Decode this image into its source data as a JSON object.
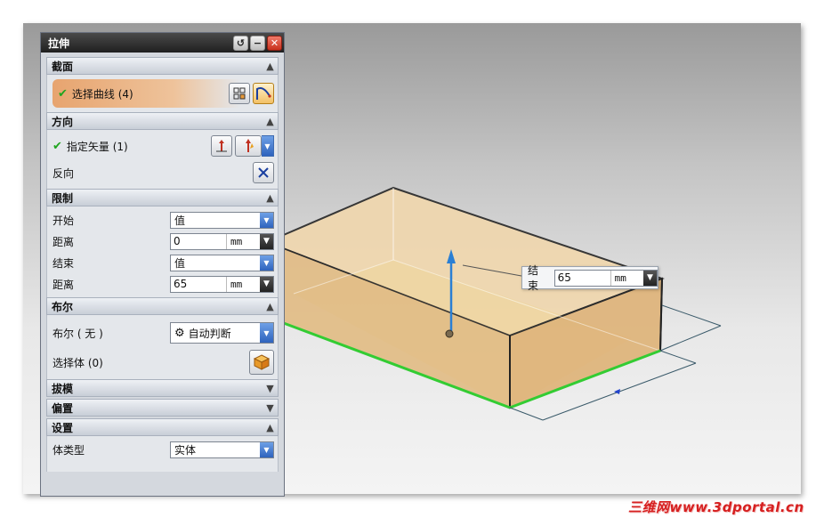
{
  "dialog": {
    "title": "拉伸",
    "sections": {
      "section": {
        "title": "截面",
        "select_curve": "选择曲线 (4)"
      },
      "direction": {
        "title": "方向",
        "specify_vector": "指定矢量 (1)",
        "reverse": "反向"
      },
      "limits": {
        "title": "限制",
        "start_label": "开始",
        "start_type": "值",
        "start_distance_label": "距离",
        "start_distance": "0",
        "end_label": "结束",
        "end_type": "值",
        "end_distance_label": "距离",
        "end_distance": "65",
        "unit": "mm"
      },
      "boolean": {
        "title": "布尔",
        "boolean_label": "布尔 ( 无 )",
        "boolean_value": "自动判断",
        "select_body": "选择体 (0)"
      },
      "draft": {
        "title": "拔模"
      },
      "offset": {
        "title": "偏置"
      },
      "settings": {
        "title": "设置",
        "body_type_label": "体类型",
        "body_type": "实体"
      }
    }
  },
  "end_tooltip": {
    "label": "结束",
    "value": "65",
    "unit": "mm"
  },
  "watermark": "三维网www.3dportal.cn",
  "colors": {
    "selection_highlight": "#e7a46f",
    "check": "#1fa51f",
    "box_face": "#e8c58e",
    "edge_selected": "#33cc33",
    "vector_arrow": "#2a7fd4",
    "watermark": "#d62020"
  },
  "icons": [
    "check-icon",
    "curve-select-icon",
    "vector-icon",
    "reverse-direction-icon",
    "auto-infer-icon",
    "body-cube-icon",
    "reset-icon",
    "minimize-icon",
    "close-icon",
    "chevron-up-icon",
    "chevron-down-icon"
  ]
}
